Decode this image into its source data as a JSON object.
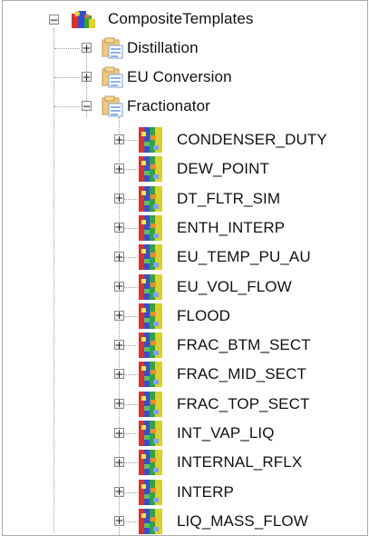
{
  "tree": {
    "root": {
      "label": "CompositeTemplates",
      "expanded": true,
      "icon": "composite-templates-icon"
    },
    "folders": [
      {
        "label": "Distillation",
        "expanded": false,
        "icon": "folder-template-icon"
      },
      {
        "label": "EU Conversion",
        "expanded": false,
        "icon": "folder-template-icon"
      },
      {
        "label": "Fractionator",
        "expanded": true,
        "icon": "folder-template-icon"
      }
    ],
    "fractionator_items": [
      {
        "label": "CONDENSER_DUTY"
      },
      {
        "label": "DEW_POINT"
      },
      {
        "label": "DT_FLTR_SIM"
      },
      {
        "label": "ENTH_INTERP"
      },
      {
        "label": "EU_TEMP_PU_AU"
      },
      {
        "label": "EU_VOL_FLOW"
      },
      {
        "label": "FLOOD"
      },
      {
        "label": "FRAC_BTM_SECT"
      },
      {
        "label": "FRAC_MID_SECT"
      },
      {
        "label": "FRAC_TOP_SECT"
      },
      {
        "label": "INT_VAP_LIQ"
      },
      {
        "label": "INTERNAL_RFLX"
      },
      {
        "label": "INTERP"
      },
      {
        "label": "LIQ_MASS_FLOW"
      }
    ],
    "item_icon": "composite-block-icon",
    "expand_glyph": "+",
    "collapse_glyph": "−"
  }
}
